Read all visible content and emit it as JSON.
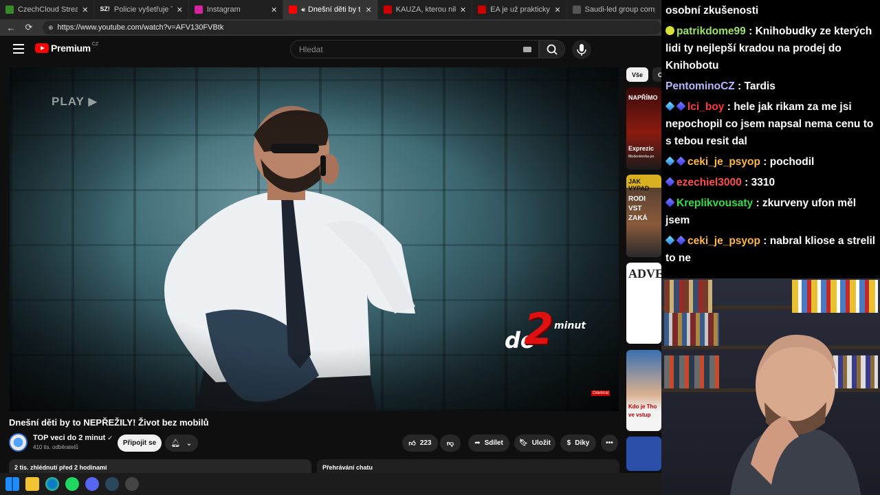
{
  "browser": {
    "tabs": [
      {
        "title": "CzechCloud Stream - Watch",
        "color": "#3a8a2a",
        "active": false
      },
      {
        "title": "Policie vyšetřuje Turkovu neh",
        "color": "#444444",
        "active": false,
        "fav_text": "SZ!"
      },
      {
        "title": "Instagram",
        "color": "#d6249f",
        "active": false
      },
      {
        "title": "Dnešní děti by to NEPŘEŽ",
        "color": "#ff0000",
        "active": true
      },
      {
        "title": "KAUZA, kterou nikdo NECHÁ",
        "color": "#cc0000",
        "active": false
      },
      {
        "title": "EA je už prakticky saúdská. E",
        "color": "#cc0000",
        "active": false
      },
      {
        "title": "Saudi-led group complet",
        "color": "#555555",
        "active": false
      }
    ],
    "url": "https://www.youtube.com/watch?v=AFV130FVBtk"
  },
  "youtube": {
    "logo_text": "Premium",
    "logo_region": "CZ",
    "search_placeholder": "Hledat",
    "video": {
      "overlay_play": "PLAY",
      "brand_do": "do",
      "brand_two": "2",
      "brand_minut": "minut",
      "odebirat": "Odebírat",
      "title": "Dnešní děti by to NEPŘEŽILY! Život bez mobilů"
    },
    "channel": {
      "name": "TOP veci do 2 minut",
      "subscribers": "410 tis. odběratelů",
      "join_label": "Připojit se"
    },
    "actions": {
      "likes": "223",
      "share": "Sdílet",
      "save": "Uložit",
      "thanks": "Díky"
    },
    "description_meta": "2 tis. zhlédnutí  před 2 hodinami",
    "chat_replay": "Přehrávání chatu",
    "chips": [
      "Vše",
      "O"
    ],
    "thumbnails": [
      {
        "text": "NAPŘÍMO",
        "sub": "Exprezic",
        "sub2": "Moderátorka po"
      },
      {
        "text": "JAK VYPAD",
        "sub": "RODI",
        "sub2": "VST",
        "sub3": "ZAKÁ"
      },
      {
        "text": "ADVE"
      },
      {
        "text": "Kdo je Tho",
        "sub": "ve vstup"
      }
    ]
  },
  "chat": [
    {
      "badges": [],
      "user": "",
      "user_color": "#ffffff",
      "text": "osobní zkušenosti"
    },
    {
      "badges": [
        "lime"
      ],
      "user": "patrikdome99",
      "user_color": "#9be36a",
      "text": "Knihobudky ze kterých lidi ty nejlepší kradou na prodej do Knihobotu"
    },
    {
      "badges": [],
      "user": "PentominoCZ",
      "user_color": "#b8b8ff",
      "text": "Tardis"
    },
    {
      "badges": [
        "cyan",
        "blue"
      ],
      "user": "lci_boy",
      "user_color": "#ff3b3b",
      "text": "hele jak rikam za me jsi nepochopil co jsem napsal nema cenu to s tebou resit dal"
    },
    {
      "badges": [
        "cyan",
        "blue"
      ],
      "user": "ceki_je_psyop",
      "user_color": "#ffb84a",
      "text": "pochodil"
    },
    {
      "badges": [
        "blue"
      ],
      "user": "ezechiel3000",
      "user_color": "#ff5050",
      "text": "3310"
    },
    {
      "badges": [
        "blue"
      ],
      "user": "Kreplikvousaty",
      "user_color": "#33dd44",
      "text": "zkurveny ufon měl jsem"
    },
    {
      "badges": [
        "cyan",
        "blue"
      ],
      "user": "ceki_je_psyop",
      "user_color": "#ffb84a",
      "text": "nabral kliose a strelil to ne"
    }
  ]
}
